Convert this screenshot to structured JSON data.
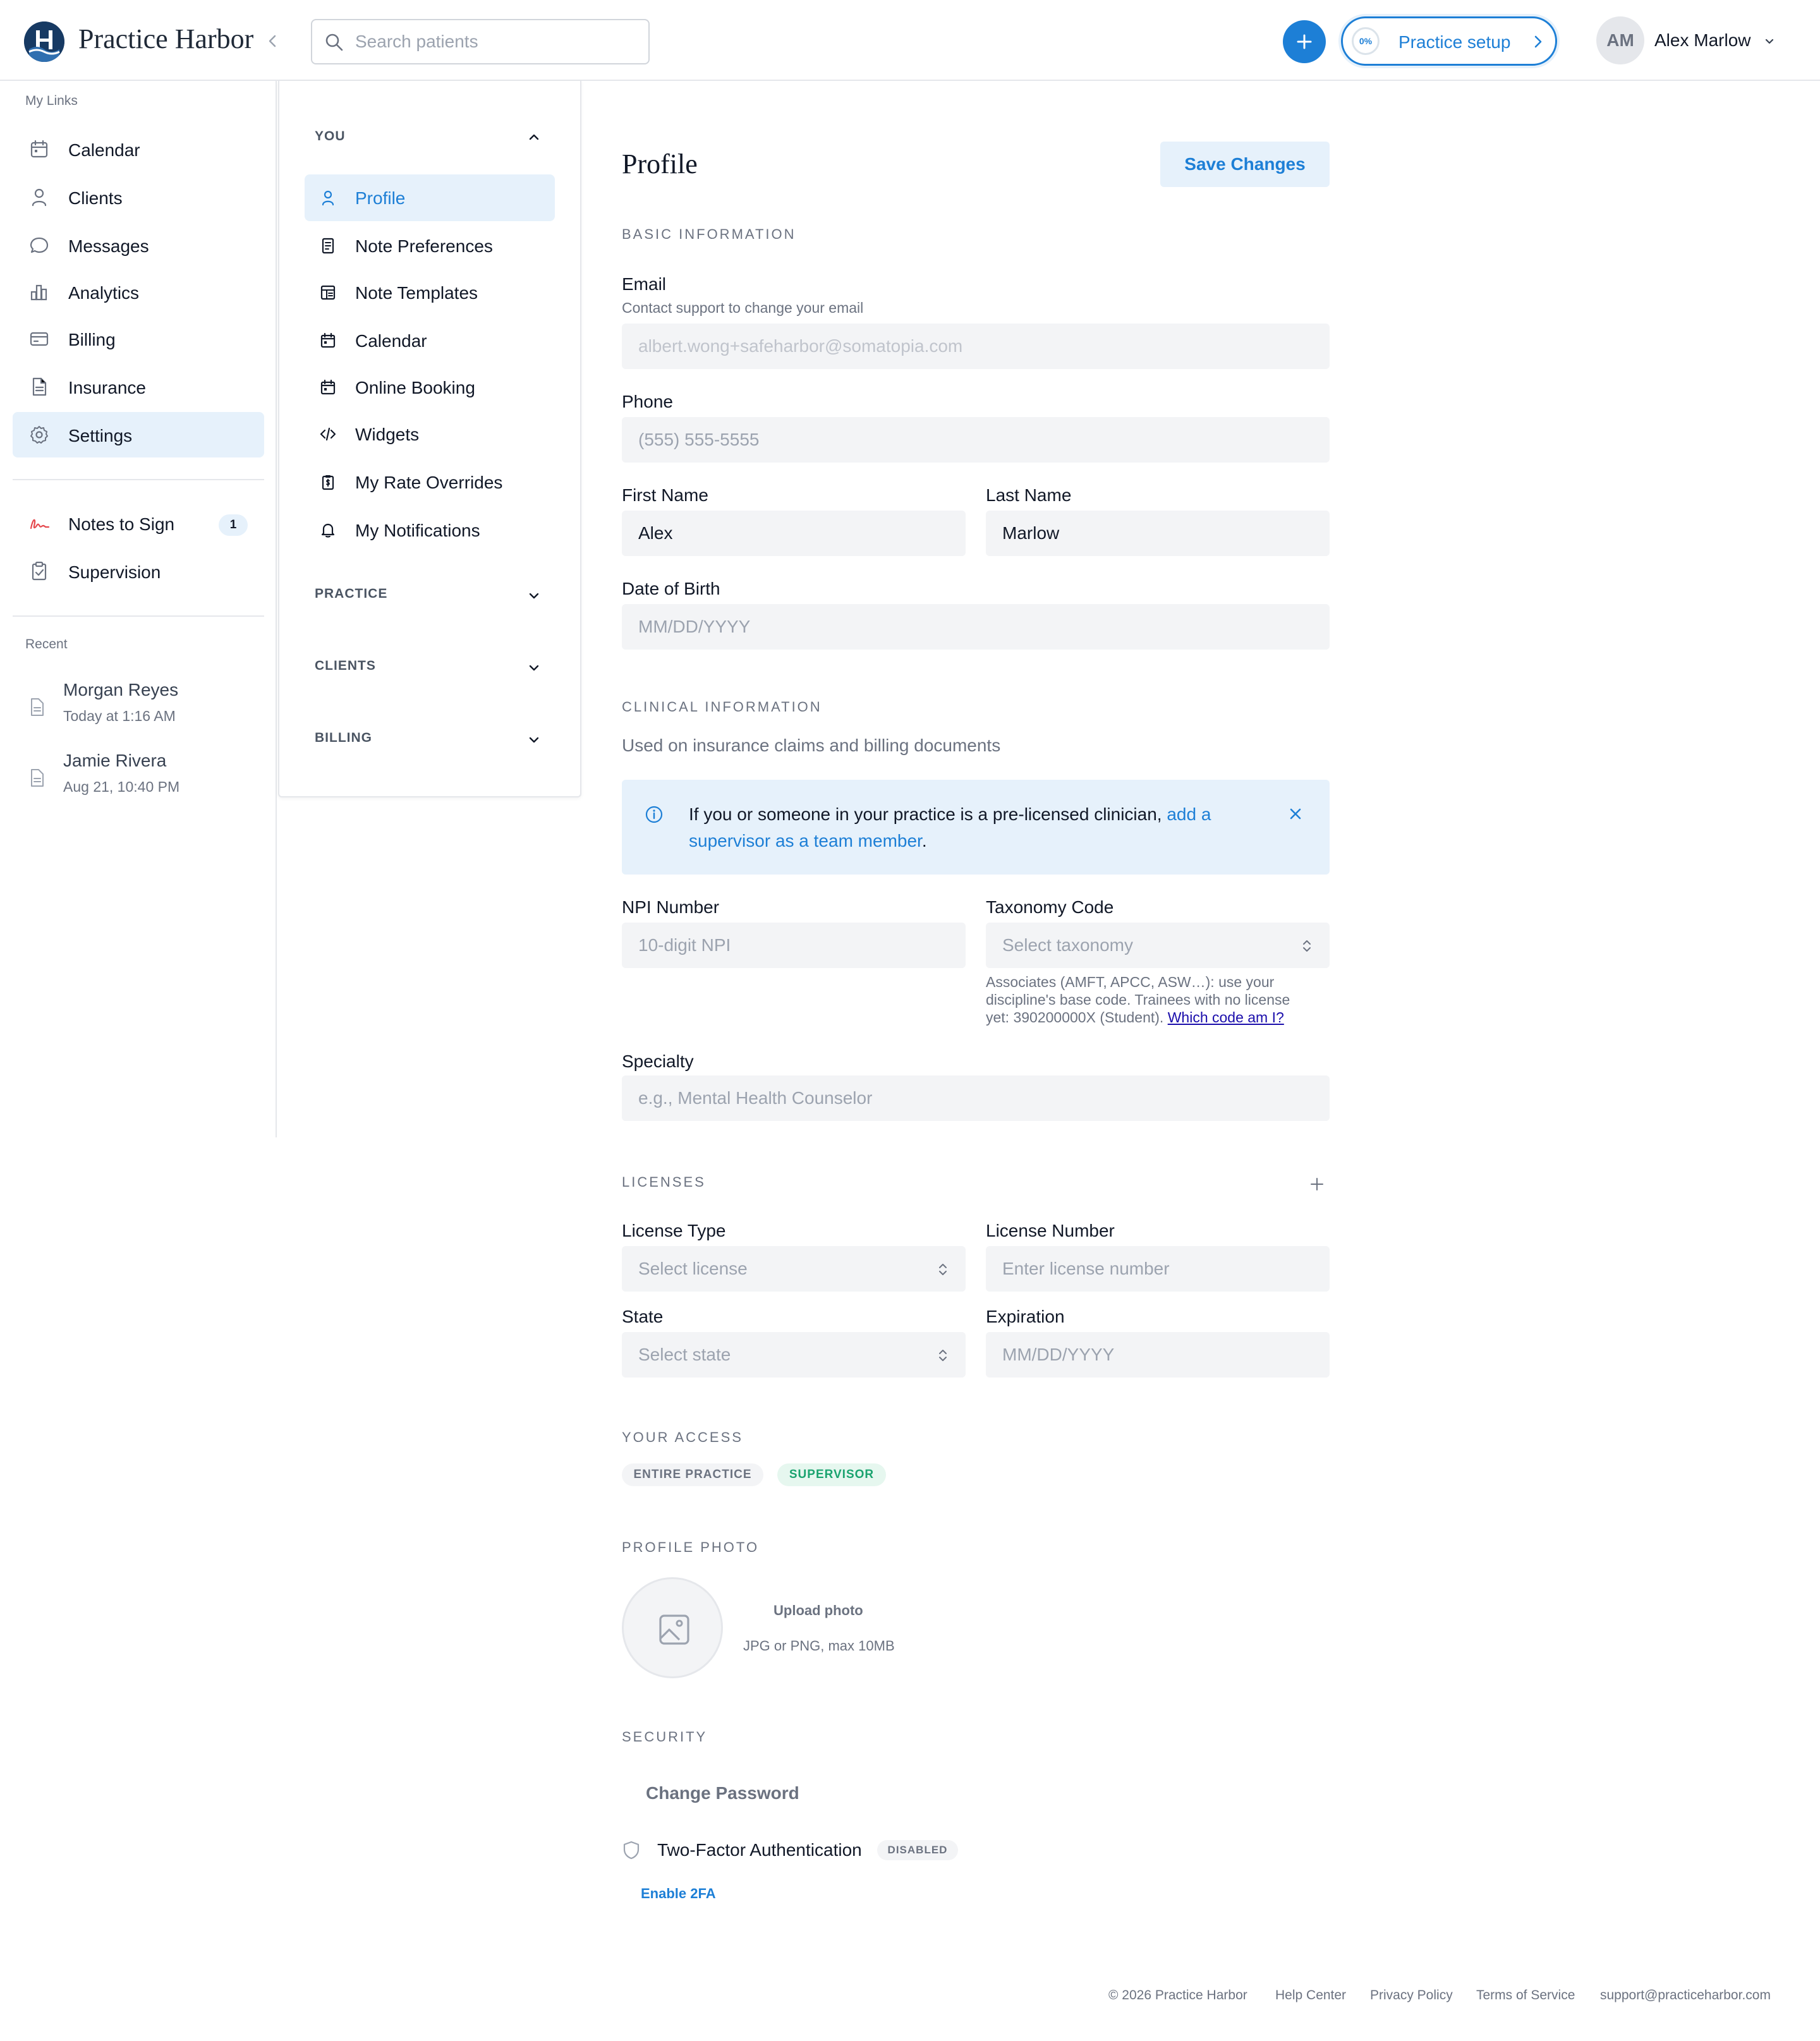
{
  "header": {
    "brand": "Practice Harbor",
    "search_placeholder": "Search patients",
    "setup_progress": "0%",
    "setup_label": "Practice setup",
    "user_initials": "AM",
    "user_name": "Alex Marlow"
  },
  "sidebar": {
    "my_links_label": "My Links",
    "items": [
      {
        "label": "Calendar",
        "icon": "calendar-icon"
      },
      {
        "label": "Clients",
        "icon": "user-icon"
      },
      {
        "label": "Messages",
        "icon": "chat-bubble-icon"
      },
      {
        "label": "Analytics",
        "icon": "bar-chart-icon"
      },
      {
        "label": "Billing",
        "icon": "credit-card-icon"
      },
      {
        "label": "Insurance",
        "icon": "document-icon"
      },
      {
        "label": "Settings",
        "icon": "gear-icon",
        "active": true
      }
    ],
    "secondary": [
      {
        "label": "Notes to Sign",
        "icon": "signature-icon",
        "count": "1"
      },
      {
        "label": "Supervision",
        "icon": "clipboard-check-icon"
      }
    ],
    "recent_label": "Recent",
    "recent": [
      {
        "name": "Morgan Reyes",
        "time": "Today at 1:16 AM"
      },
      {
        "name": "Jamie Rivera",
        "time": "Aug 21, 10:40 PM"
      }
    ]
  },
  "settings_nav": {
    "you_label": "YOU",
    "you_items": [
      {
        "label": "Profile",
        "icon": "user-icon",
        "active": true
      },
      {
        "label": "Note Preferences",
        "icon": "note-icon"
      },
      {
        "label": "Note Templates",
        "icon": "template-icon"
      },
      {
        "label": "Calendar",
        "icon": "calendar-icon"
      },
      {
        "label": "Online Booking",
        "icon": "calendar-icon"
      },
      {
        "label": "Widgets",
        "icon": "code-icon"
      },
      {
        "label": "My Rate Overrides",
        "icon": "dollar-clipboard-icon"
      },
      {
        "label": "My Notifications",
        "icon": "bell-icon"
      }
    ],
    "groups": [
      "PRACTICE",
      "CLIENTS",
      "BILLING"
    ]
  },
  "profile": {
    "title": "Profile",
    "save_label": "Save Changes",
    "basic_section": "BASIC INFORMATION",
    "email_label": "Email",
    "email_hint": "Contact support to change your email",
    "email_value": "albert.wong+safeharbor@somatopia.com",
    "phone_label": "Phone",
    "phone_placeholder": "(555) 555-5555",
    "first_name_label": "First Name",
    "first_name_value": "Alex",
    "last_name_label": "Last Name",
    "last_name_value": "Marlow",
    "dob_label": "Date of Birth",
    "dob_placeholder": "MM/DD/YYYY",
    "clinical_section": "CLINICAL INFORMATION",
    "clinical_sub": "Used on insurance claims and billing documents",
    "info_text": "If you or someone in your practice is a pre-licensed clinician, ",
    "info_link": "add a supervisor as a team member",
    "info_end": ".",
    "npi_label": "NPI Number",
    "npi_placeholder": "10-digit NPI",
    "taxonomy_label": "Taxonomy Code",
    "taxonomy_placeholder": "Select taxonomy",
    "taxonomy_hint": "Associates (AMFT, APCC, ASW…): use your discipline's base code. Trainees with no license yet: 390200000X (Student). ",
    "taxonomy_link": "Which code am I?",
    "specialty_label": "Specialty",
    "specialty_placeholder": "e.g., Mental Health Counselor",
    "licenses_section": "LICENSES",
    "license_type_label": "License Type",
    "license_type_placeholder": "Select license",
    "license_number_label": "License Number",
    "license_number_placeholder": "Enter license number",
    "state_label": "State",
    "state_placeholder": "Select state",
    "expiration_label": "Expiration",
    "expiration_placeholder": "MM/DD/YYYY",
    "access_section": "YOUR ACCESS",
    "access_chips": [
      "ENTIRE PRACTICE",
      "SUPERVISOR"
    ],
    "photo_section": "PROFILE PHOTO",
    "upload_label": "Upload photo",
    "upload_hint": "JPG or PNG, max 10MB",
    "security_section": "SECURITY",
    "change_password": "Change Password",
    "twofa_label": "Two-Factor Authentication",
    "twofa_status": "DISABLED",
    "enable_2fa": "Enable 2FA"
  },
  "footer": {
    "copyright": "© 2026 Practice Harbor",
    "help": "Help Center",
    "privacy": "Privacy Policy",
    "terms": "Terms of Service",
    "support": "support@practiceharbor.com"
  },
  "colors": {
    "accent": "#1d7fd6",
    "accent_light": "#e6f1fb",
    "brand_navy": "#173a63",
    "success": "#1aa36f"
  }
}
